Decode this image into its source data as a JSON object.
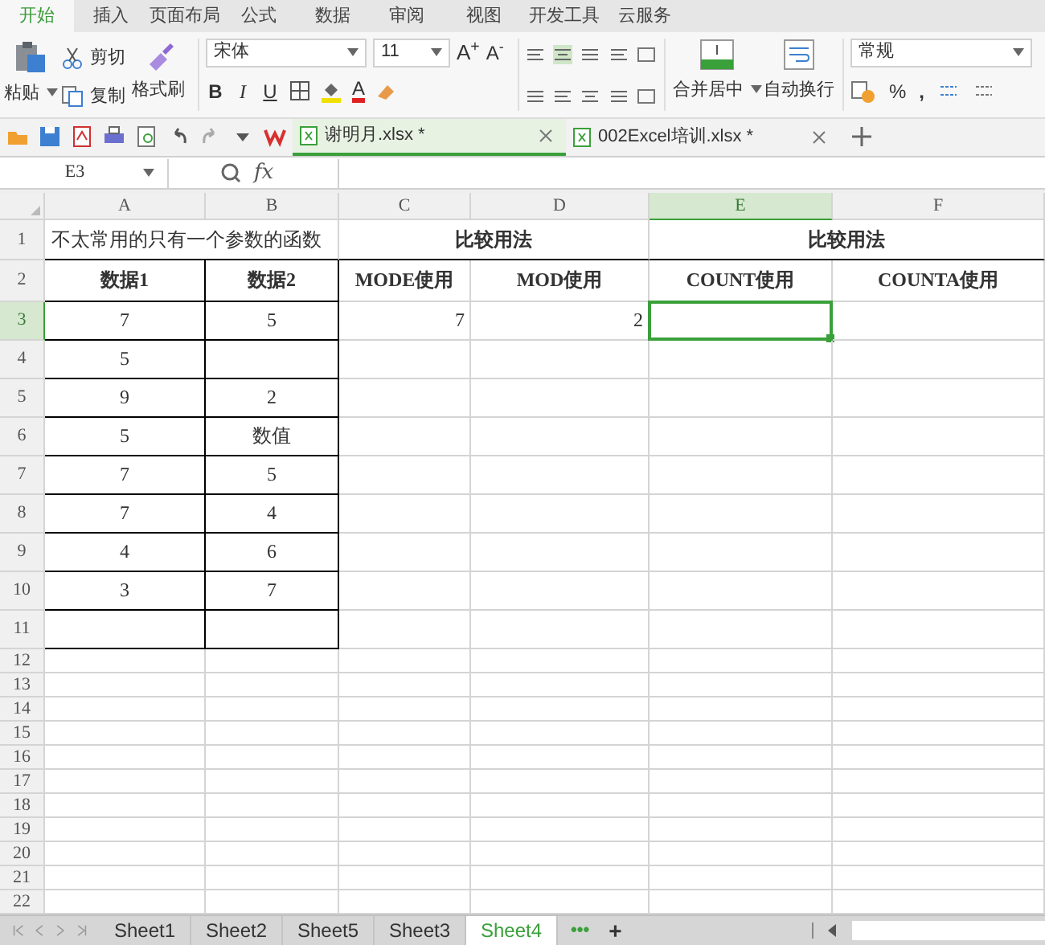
{
  "menu_tabs": [
    {
      "label": "开始",
      "selected": true
    },
    {
      "label": "插入",
      "selected": false
    },
    {
      "label": "页面布局",
      "selected": false
    },
    {
      "label": "公式",
      "selected": false
    },
    {
      "label": "数据",
      "selected": false
    },
    {
      "label": "审阅",
      "selected": false
    },
    {
      "label": "视图",
      "selected": false
    },
    {
      "label": "开发工具",
      "selected": false
    },
    {
      "label": "云服务",
      "selected": false
    }
  ],
  "ribbon": {
    "paste": "粘贴",
    "cut": "剪切",
    "copy": "复制",
    "format_painter": "格式刷",
    "font_name": "宋体",
    "font_size": "11",
    "grow_font": "A$^{+}$",
    "shrink_font": "A$^{-}$",
    "bold": "B",
    "italic": "I",
    "underline": "U",
    "font_color": "A",
    "merge_center": "合并居中",
    "wrap_text": "自动换行",
    "number_format": "常规",
    "percent": "%",
    "thousands": ","
  },
  "doc_tabs": [
    {
      "label": "谢明月.xlsx *",
      "selected": true
    },
    {
      "label": "002Excel培训.xlsx *",
      "selected": false
    }
  ],
  "name_box": "E3",
  "fx": "fx",
  "columns": [
    {
      "label": "A",
      "selected": false
    },
    {
      "label": "B",
      "selected": false
    },
    {
      "label": "C",
      "selected": false
    },
    {
      "label": "D",
      "selected": false
    },
    {
      "label": "E",
      "selected": true
    },
    {
      "label": "F",
      "selected": false
    }
  ],
  "rows": [
    {
      "label": "1",
      "selected": false,
      "kind": "title",
      "cells": [
        "不太常用的只有一个参数的函数",
        "比较用法",
        "比较用法"
      ]
    },
    {
      "label": "2",
      "selected": false,
      "kind": "header",
      "cells": [
        "数据1",
        "数据2",
        "MODE使用",
        "MOD使用",
        "COUNT使用",
        "COUNTA使用"
      ]
    },
    {
      "label": "3",
      "selected": true,
      "kind": "data",
      "cells": [
        "7",
        "5",
        "7",
        "2"
      ]
    },
    {
      "label": "4",
      "selected": false,
      "kind": "data",
      "cells": [
        "5"
      ]
    },
    {
      "label": "5",
      "selected": false,
      "kind": "data",
      "cells": [
        "9",
        "2"
      ]
    },
    {
      "label": "6",
      "selected": false,
      "kind": "data",
      "cells": [
        "5",
        "数值"
      ]
    },
    {
      "label": "7",
      "selected": false,
      "kind": "data",
      "cells": [
        "7",
        "5"
      ]
    },
    {
      "label": "8",
      "selected": false,
      "kind": "data",
      "cells": [
        "7",
        "4"
      ]
    },
    {
      "label": "9",
      "selected": false,
      "kind": "data",
      "cells": [
        "4",
        "6"
      ]
    },
    {
      "label": "10",
      "selected": false,
      "kind": "data",
      "cells": [
        "3",
        "7"
      ]
    },
    {
      "label": "11",
      "selected": false,
      "kind": "data"
    },
    {
      "label": "12",
      "selected": false,
      "kind": "plain"
    },
    {
      "label": "13",
      "selected": false,
      "kind": "plain"
    },
    {
      "label": "14",
      "selected": false,
      "kind": "plain"
    },
    {
      "label": "15",
      "selected": false,
      "kind": "plain"
    },
    {
      "label": "16",
      "selected": false,
      "kind": "plain"
    },
    {
      "label": "17",
      "selected": false,
      "kind": "plain"
    },
    {
      "label": "18",
      "selected": false,
      "kind": "plain"
    },
    {
      "label": "19",
      "selected": false,
      "kind": "plain"
    },
    {
      "label": "20",
      "selected": false,
      "kind": "plain"
    },
    {
      "label": "21",
      "selected": false,
      "kind": "plain"
    },
    {
      "label": "22",
      "selected": false,
      "kind": "plain"
    }
  ],
  "sheet_tabs": [
    {
      "label": "Sheet1",
      "selected": false
    },
    {
      "label": "Sheet2",
      "selected": false
    },
    {
      "label": "Sheet5",
      "selected": false
    },
    {
      "label": "Sheet3",
      "selected": false
    },
    {
      "label": "Sheet4",
      "selected": true
    }
  ],
  "more_sheets": "•••",
  "add_sheet": "+"
}
